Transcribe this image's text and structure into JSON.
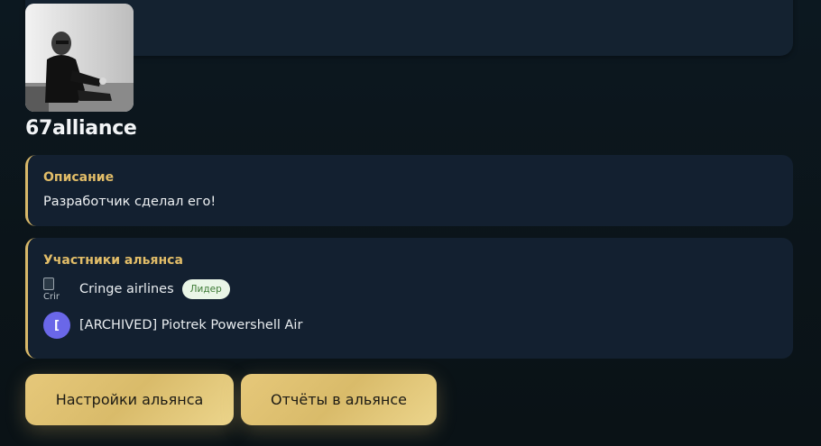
{
  "alliance": {
    "name": "67alliance"
  },
  "description": {
    "title": "Описание",
    "text": "Разработчик сделал его!"
  },
  "members": {
    "title": "Участники альянса",
    "items": [
      {
        "name": "Cringe airlines",
        "avatar_alt": "Crir",
        "badge": "Лидер"
      },
      {
        "name": "[ARCHIVED] Piotrek Powershell Air",
        "avatar_letter": "["
      }
    ]
  },
  "buttons": {
    "settings": "Настройки альянса",
    "reports": "Отчёты в альянсе"
  },
  "colors": {
    "accent_gold": "#e2bd68",
    "badge_green": "#3d7a35",
    "member_avatar": "#6a67e8"
  }
}
